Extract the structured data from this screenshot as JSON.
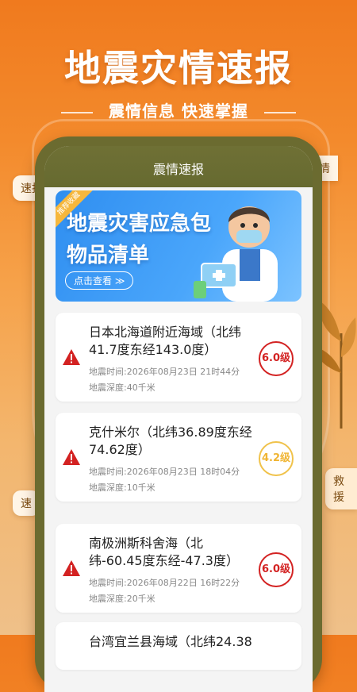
{
  "promo": {
    "title": "地震灾情速报",
    "subtitle": "震情信息 快速掌握"
  },
  "background_tags": {
    "left_top": "速报",
    "right_top": "情",
    "right_mid": "救援",
    "left_mid": "速"
  },
  "app": {
    "header_title": "震情速报"
  },
  "banner": {
    "ribbon": "推荐收藏",
    "title_line1": "地震灾害应急包",
    "title_line2": "物品清单",
    "button": "点击查看 ≫"
  },
  "quakes": [
    {
      "place": "日本北海道附近海域（北纬41.7度东经143.0度）",
      "time": "地震时间:2026年08月23日 21时44分",
      "depth": "地震深度:40千米",
      "magnitude": "6.0级",
      "level": "red"
    },
    {
      "place": "克什米尔（北纬36.89度东经74.62度）",
      "time": "地震时间:2026年08月23日 18时04分",
      "depth": "地震深度:10千米",
      "magnitude": "4.2级",
      "level": "yellow"
    },
    {
      "place": "南极洲斯科舍海（北纬-60.45度东经-47.3度）",
      "time": "地震时间:2026年08月22日 16时22分",
      "depth": "地震深度:20千米",
      "magnitude": "6.0级",
      "level": "red"
    },
    {
      "place": "台湾宜兰县海域（北纬24.38"
    }
  ],
  "colors": {
    "accent_orange": "#f07a1e",
    "header_olive": "#6b6b30",
    "banner_blue": "#2f8ef0",
    "alert_red": "#d32222",
    "alert_yellow": "#f0b533"
  }
}
